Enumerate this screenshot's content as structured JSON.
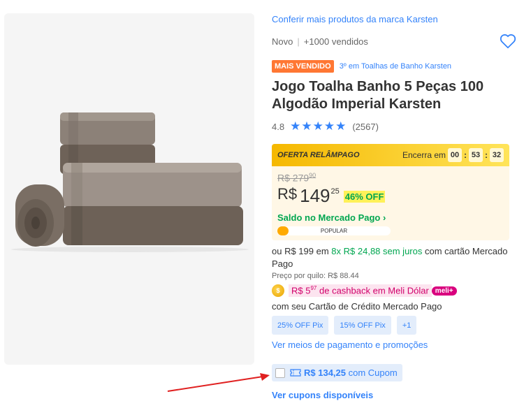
{
  "product": {
    "brand_link": "Conferir mais produtos da marca Karsten",
    "condition": "Novo",
    "sold": "+1000 vendidos",
    "badge": "MAIS VENDIDO",
    "rank": "3º em Toalhas de Banho Karsten",
    "title": "Jogo Toalha Banho 5 Peças 100 Algodão Imperial Karsten",
    "rating": "4.8",
    "review_count": "(2567)",
    "stars": 5
  },
  "flash": {
    "label": "OFERTA RELÂMPAGO",
    "ends_label": "Encerra em",
    "hours": "00",
    "minutes": "53",
    "seconds": "32"
  },
  "price": {
    "old_main": "R$ 279",
    "old_cents": "90",
    "currency": "R$",
    "main": "149",
    "cents": "25",
    "discount": "46% OFF",
    "saldo": "Saldo no Mercado Pago",
    "popular": "POPULAR",
    "popular_fraction": 0.1
  },
  "installments": {
    "prefix": "ou R$ 199 em",
    "highlight": "8x R$ 24,88 sem juros",
    "suffix": "com cartão Mercado Pago",
    "price_per_kilo": "Preço por quilo: R$ 88.44"
  },
  "cashback": {
    "text": "R$ 5",
    "cents": "97",
    "suffix": "de cashback em Meli Dólar",
    "meli_badge": "meli+",
    "card_line": "com seu Cartão de Crédito Mercado Pago"
  },
  "chips": [
    "25% OFF Pix",
    "15% OFF Pix",
    "+1"
  ],
  "payment_link": "Ver meios de pagamento e promoções",
  "coupon": {
    "amount": "R$ 134,25",
    "label": "com Cupom"
  },
  "coupons_link": "Ver cupons disponíveis",
  "colors": {
    "accent": "#3483fa",
    "green": "#00a650",
    "badge": "#ff7733",
    "flash": "#f5b800",
    "arrow": "#e02020"
  }
}
